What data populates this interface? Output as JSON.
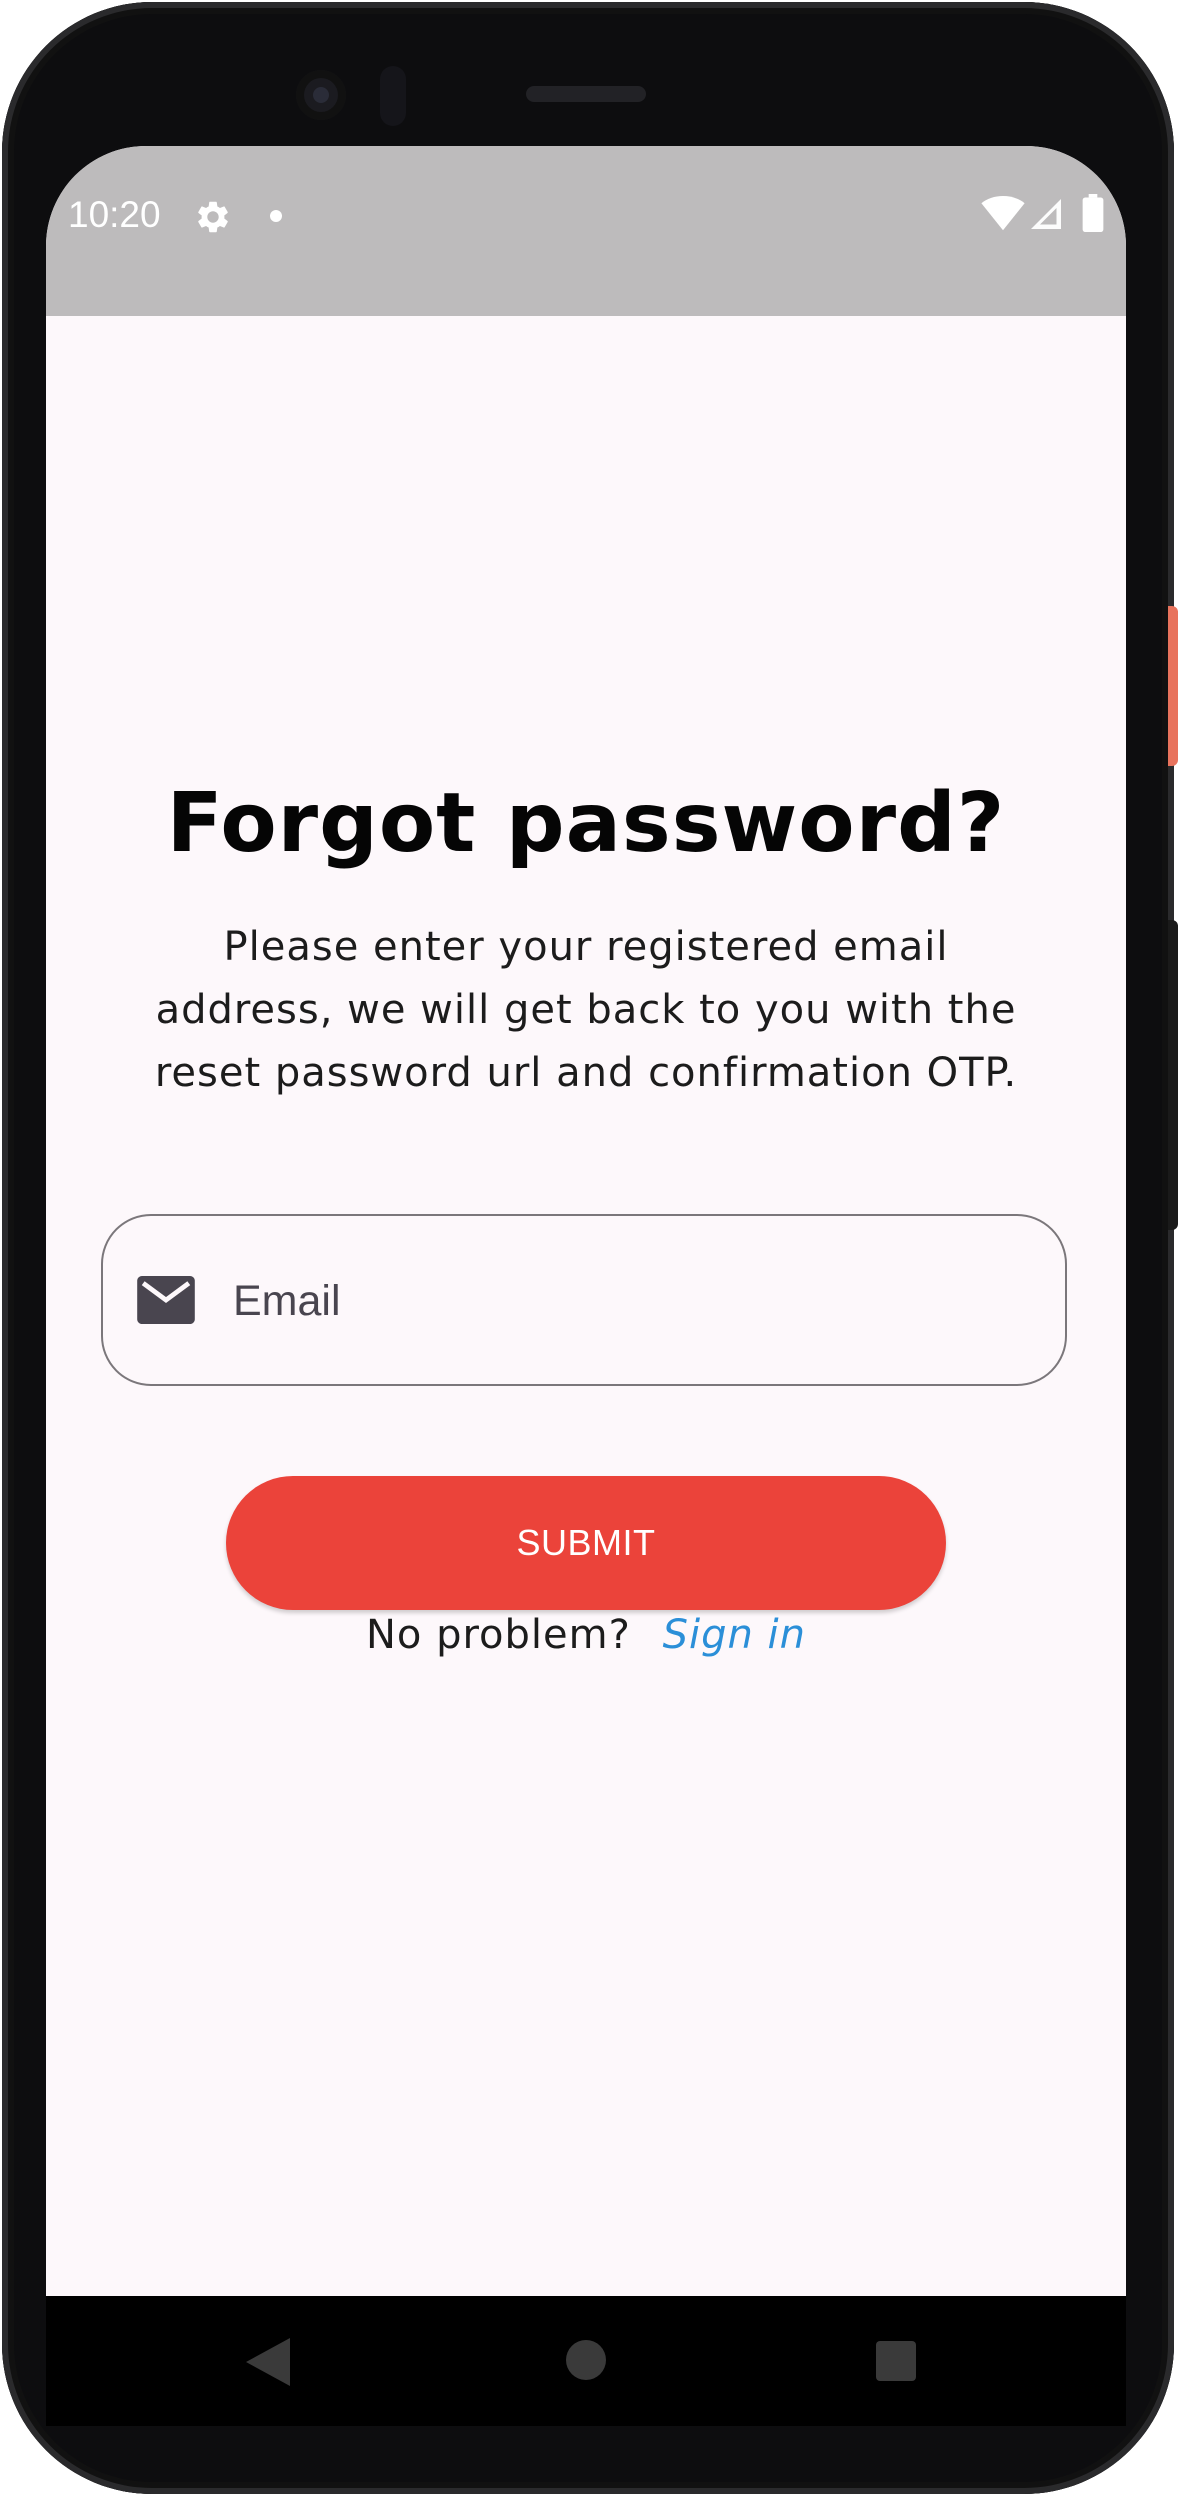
{
  "status_bar": {
    "time": "10:20"
  },
  "icons": {
    "settings": "gear-icon",
    "notification_dot": "dot-icon",
    "wifi": "wifi-icon",
    "signal": "signal-icon",
    "battery": "battery-icon",
    "email": "mail-icon",
    "nav_back": "back-triangle-icon",
    "nav_home": "home-circle-icon",
    "nav_recents": "recents-square-icon"
  },
  "page": {
    "title": "Forgot password?",
    "subtitle_lines": [
      "Please enter your registered email",
      "address, we will get back to you with the",
      "reset password url and confirmation OTP."
    ]
  },
  "form": {
    "email_placeholder": "Email",
    "email_value": "",
    "submit_label": "SUBMIT"
  },
  "footer": {
    "prompt": "No problem?",
    "link": "Sign in"
  },
  "colors": {
    "accent": "#eb433a",
    "link": "#2b8fd8",
    "background": "#fdf8fb",
    "status_bar": "#bdbbbc"
  }
}
